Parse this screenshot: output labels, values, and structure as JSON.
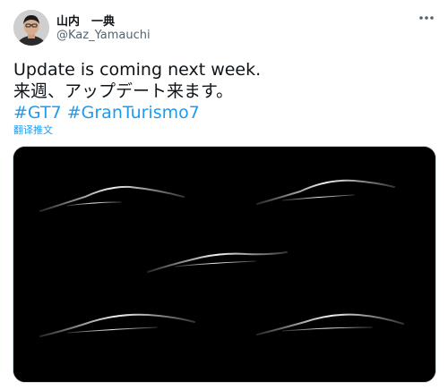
{
  "author": {
    "display_name": "山内　一典",
    "handle": "@Kaz_Yamauchi"
  },
  "tweet": {
    "line1": "Update is coming next week.",
    "line2": "来週、アップデート来ます。",
    "hashtags": [
      "#GT7",
      "#GranTurismo7"
    ],
    "translate_label": "翻译推文"
  },
  "icons": {
    "more": "more-dots-icon",
    "avatar": "person-avatar"
  },
  "colors": {
    "link": "#1d9bf0",
    "text": "#0f1419",
    "secondary": "#536471",
    "media_bg": "#000000"
  }
}
